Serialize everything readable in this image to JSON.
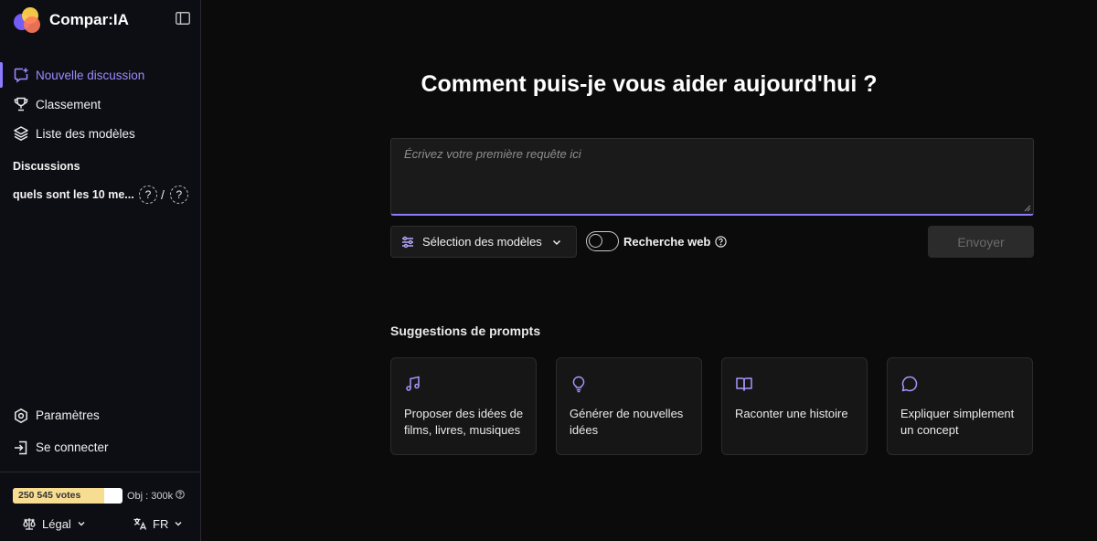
{
  "brand": {
    "name": "Compar:IA"
  },
  "nav": {
    "items": [
      {
        "label": "Nouvelle discussion",
        "icon": "new-chat-icon",
        "active": true
      },
      {
        "label": "Classement",
        "icon": "trophy-icon"
      },
      {
        "label": "Liste des modèles",
        "icon": "layers-icon"
      }
    ]
  },
  "discussions": {
    "title": "Discussions",
    "items": [
      {
        "label": "quels sont les 10 me...",
        "model_a": "?",
        "separator": "/",
        "model_b": "?"
      }
    ]
  },
  "bottom_nav": {
    "items": [
      {
        "label": "Paramètres",
        "icon": "settings-icon"
      },
      {
        "label": "Se connecter",
        "icon": "login-icon"
      }
    ]
  },
  "footer": {
    "votes_label": "250 545 votes",
    "votes_progress": 0.835,
    "objective": "Obj : 300k",
    "legal_label": "Légal",
    "language_label": "FR"
  },
  "main": {
    "heading": "Comment puis-je vous aider aujourd'hui ?",
    "prompt_placeholder": "Écrivez votre première requête ici",
    "model_select_label": "Sélection des modèles",
    "web_search_label": "Recherche web",
    "send_label": "Envoyer"
  },
  "suggestions": {
    "title": "Suggestions de prompts",
    "cards": [
      {
        "label": "Proposer des idées de films, livres, musiques",
        "icon": "music-note-icon"
      },
      {
        "label": "Générer de nouvelles idées",
        "icon": "lightbulb-icon"
      },
      {
        "label": "Raconter une histoire",
        "icon": "book-icon"
      },
      {
        "label": "Expliquer simplement un concept",
        "icon": "speech-bubble-icon"
      }
    ]
  },
  "colors": {
    "accent": "#8b7bff",
    "background": "#0b0b0b",
    "sidebar": "#0d0d14",
    "votes_fill": "#f7dd92"
  }
}
